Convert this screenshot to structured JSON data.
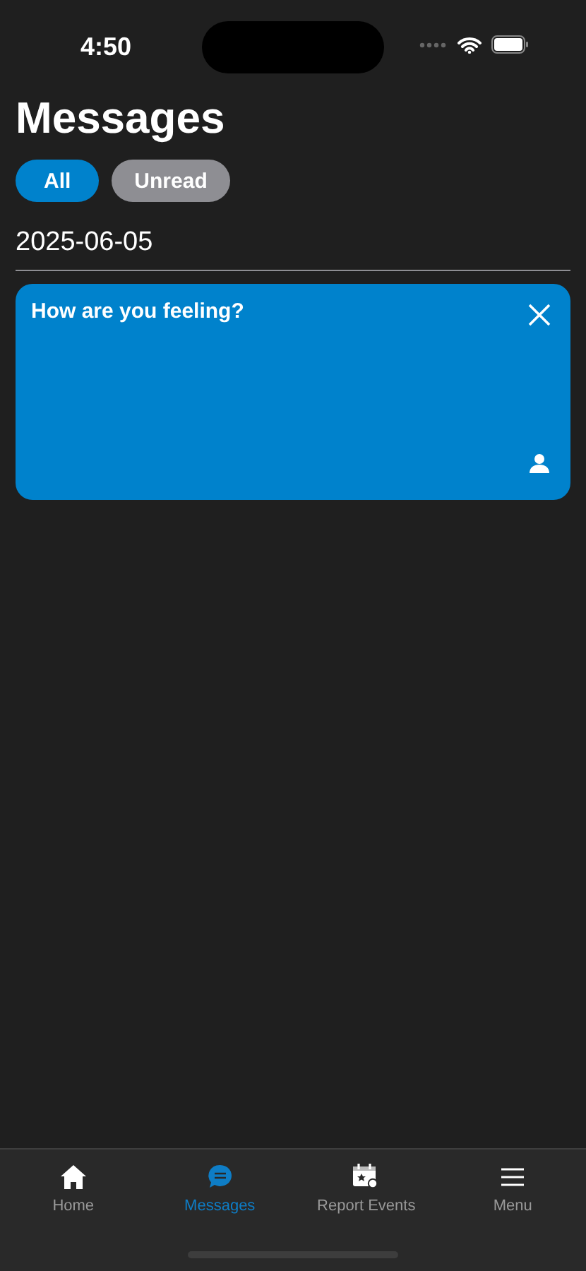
{
  "status_bar": {
    "time": "4:50"
  },
  "title": "Messages",
  "filters": [
    {
      "label": "All",
      "selected": true
    },
    {
      "label": "Unread",
      "selected": false
    }
  ],
  "groups": [
    {
      "date": "2025-06-05",
      "messages": [
        {
          "text": "How are you feeling?"
        }
      ]
    }
  ],
  "tab_bar": [
    {
      "label": "Home",
      "kind": "home",
      "selected": false
    },
    {
      "label": "Messages",
      "kind": "messages",
      "selected": true
    },
    {
      "label": "Report Events",
      "kind": "calendar",
      "selected": false
    },
    {
      "label": "Menu",
      "kind": "menu",
      "selected": false
    }
  ]
}
